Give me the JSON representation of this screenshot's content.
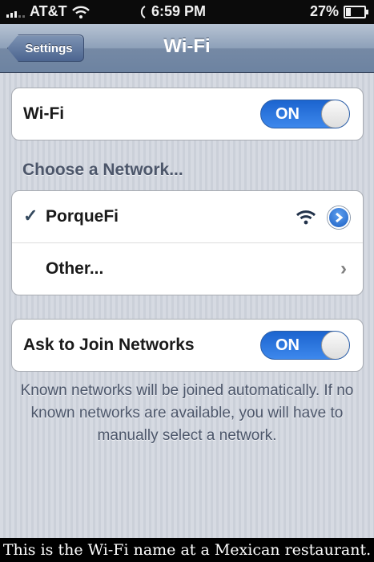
{
  "status_bar": {
    "carrier": "AT&T",
    "time": "6:59 PM",
    "battery": "27%",
    "battery_level": 0.27
  },
  "nav": {
    "back_label": "Settings",
    "title": "Wi-Fi"
  },
  "wifi_toggle": {
    "label": "Wi-Fi",
    "state": "ON"
  },
  "network_section": {
    "header": "Choose a Network...",
    "networks": [
      {
        "check": "✓",
        "name": "PorqueFi",
        "selected": true
      },
      {
        "name": "Other..."
      }
    ]
  },
  "ask_join": {
    "label": "Ask to Join Networks",
    "state": "ON"
  },
  "footer": "Known networks will be joined automatically. If no known networks are available, you will have to manually select a network.",
  "caption": "This is the Wi-Fi name at a Mexican restaurant.",
  "colors": {
    "toggle_on": "#2f77e0",
    "navbar": "#7d91ad",
    "background": "#d1d5dd"
  }
}
